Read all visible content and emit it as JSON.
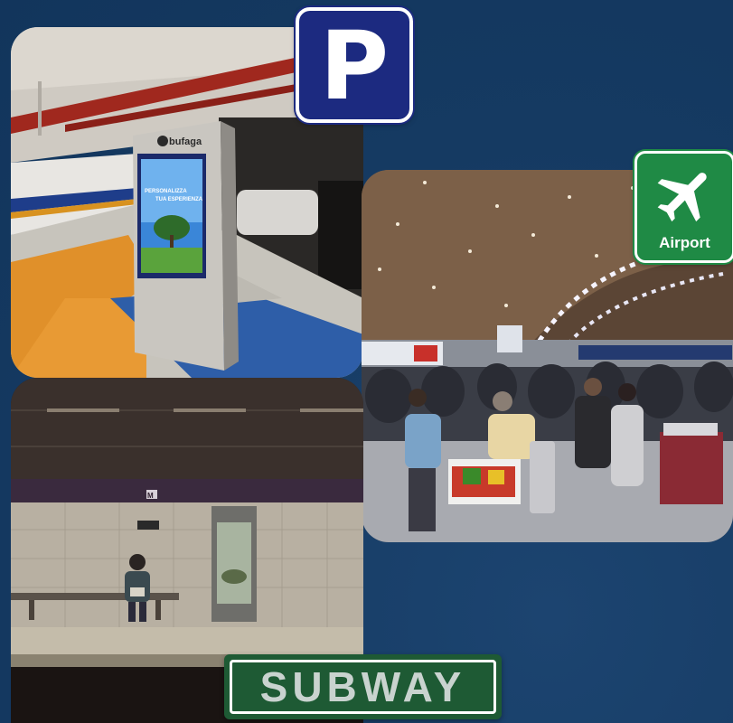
{
  "parking_sign": {
    "letter": "P",
    "color": "#1c2a80"
  },
  "parking_photo": {
    "kiosk_brand": "bufaga",
    "kiosk_screen_text": "PERSONALIZZA\nTUA ESPERIENZA"
  },
  "airport_sign": {
    "label": "Airport",
    "icon": "airplane-icon",
    "color": "#1f8a45"
  },
  "subway_sign": {
    "label": "SUBWAY",
    "color": "#1e5a34"
  },
  "subway_photo": {
    "station_marker": "M"
  },
  "background_color": "#153a62"
}
